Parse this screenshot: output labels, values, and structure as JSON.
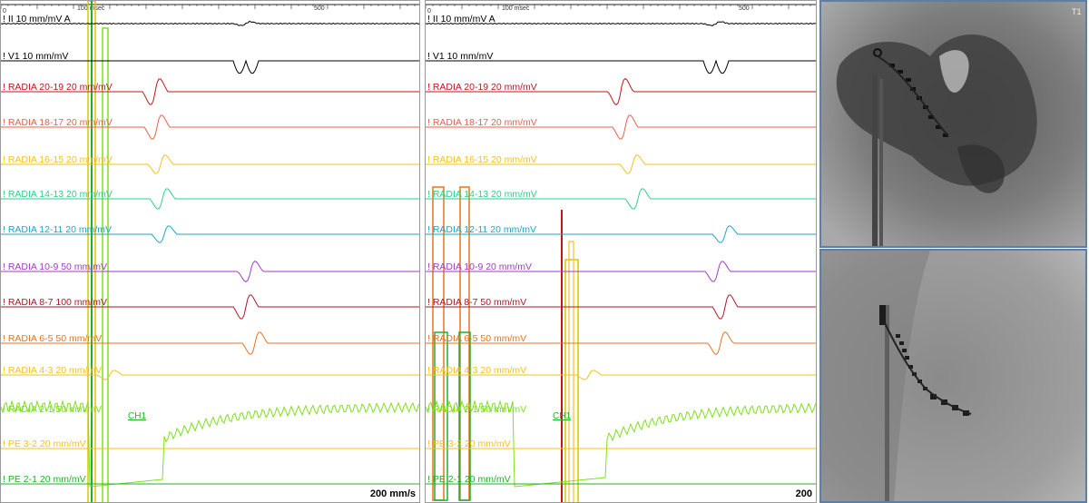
{
  "left_panel": {
    "ruler": {
      "start": "0",
      "unit": "100 msec",
      "mid": "500"
    },
    "speed": "200 mm/s",
    "ch1": "CH1",
    "channels": [
      {
        "label": "! II  10 mm/mV   A",
        "color": "#000000"
      },
      {
        "label": "! V1  10 mm/mV",
        "color": "#000000"
      },
      {
        "label": "! RADIA 20-19  20 mm/mV",
        "color": "#c0161e"
      },
      {
        "label": "! RADIA 18-17  20 mm/mV",
        "color": "#e8604a"
      },
      {
        "label": "! RADIA 16-15  20 mm/mV",
        "color": "#f2c21f"
      },
      {
        "label": "! RADIA 14-13  20 mm/mV",
        "color": "#2fcf8a"
      },
      {
        "label": "! RADIA 12-11  20 mm/mV",
        "color": "#1aa6c4"
      },
      {
        "label": "! RADIA 10-9  50 mm/mV",
        "color": "#a13cc1"
      },
      {
        "label": "! RADIA 8-7  100 mm/mV",
        "color": "#b01528"
      },
      {
        "label": "! RADIA 6-5  50 mm/mV",
        "color": "#e8731e"
      },
      {
        "label": "! RADIA 4-3  20 mm/mV",
        "color": "#f2c21f"
      },
      {
        "label": "! RADIA 2-1  50 mm/mV",
        "color": "#7fe01c"
      },
      {
        "label": "! PE 3-2  20 mm/mV",
        "color": "#f2c21f"
      },
      {
        "label": "! PE 2-1  20 mm/mV",
        "color": "#22b02a"
      }
    ]
  },
  "right_panel": {
    "ruler": {
      "start": "0",
      "unit": "100 msec",
      "mid": "500"
    },
    "speed": "200",
    "ch1": "CH1",
    "channels": [
      {
        "label": "! II  10 mm/mV   A",
        "color": "#000000"
      },
      {
        "label": "! V1  10 mm/mV",
        "color": "#000000"
      },
      {
        "label": "! RADIA 20-19  20 mm/mV",
        "color": "#c0161e"
      },
      {
        "label": "! RADIA 18-17  20 mm/mV",
        "color": "#e8604a"
      },
      {
        "label": "! RADIA 16-15  20 mm/mV",
        "color": "#f2c21f"
      },
      {
        "label": "! RADIA 14-13  20 mm/mV",
        "color": "#2fcf8a"
      },
      {
        "label": "! RADIA 12-11  20 mm/mV",
        "color": "#1aa6c4"
      },
      {
        "label": "! RADIA 10-9  20 mm/mV",
        "color": "#a13cc1"
      },
      {
        "label": "! RADIA 8-7  50 mm/mV",
        "color": "#b01528"
      },
      {
        "label": "! RADIA 6-5  50 mm/mV",
        "color": "#e8731e"
      },
      {
        "label": "! RADIA 4-3  20 mm/mV",
        "color": "#f2c21f"
      },
      {
        "label": "! RADIA 2-1  50 mm/mV",
        "color": "#7fe01c"
      },
      {
        "label": "! PE 3-2  20 mm/mV",
        "color": "#f2c21f"
      },
      {
        "label": "! PE 2-1  20 mm/mV",
        "color": "#22b02a"
      }
    ]
  },
  "fluoroscopy": {
    "top": {
      "view": "catheter-lateral",
      "corner_tag": "T1"
    },
    "bottom": {
      "view": "catheter-oblique"
    }
  }
}
